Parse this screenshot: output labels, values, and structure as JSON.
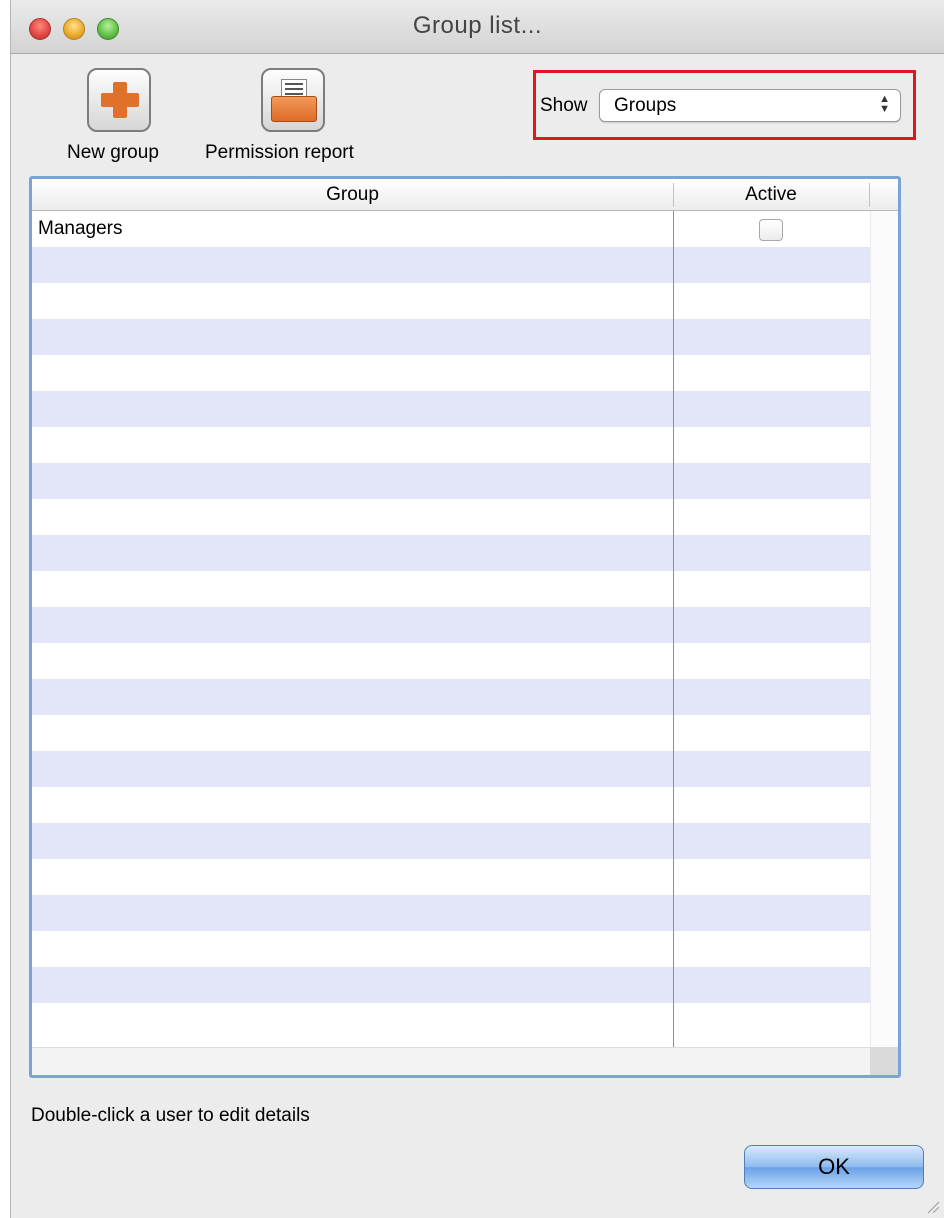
{
  "window": {
    "title": "Group list..."
  },
  "toolbar": {
    "new_group_label": "New group",
    "permission_report_label": "Permission report"
  },
  "filter": {
    "label": "Show",
    "selected": "Groups"
  },
  "table": {
    "columns": [
      "Group",
      "Active"
    ],
    "rows": [
      {
        "group": "Managers",
        "active": false
      }
    ]
  },
  "footer": {
    "hint": "Double-click a user to edit details",
    "ok_label": "OK"
  },
  "colors": {
    "highlight_border": "#e0161e",
    "row_stripe": "#e3e6f9",
    "table_focus_border": "#7aa4d6"
  }
}
